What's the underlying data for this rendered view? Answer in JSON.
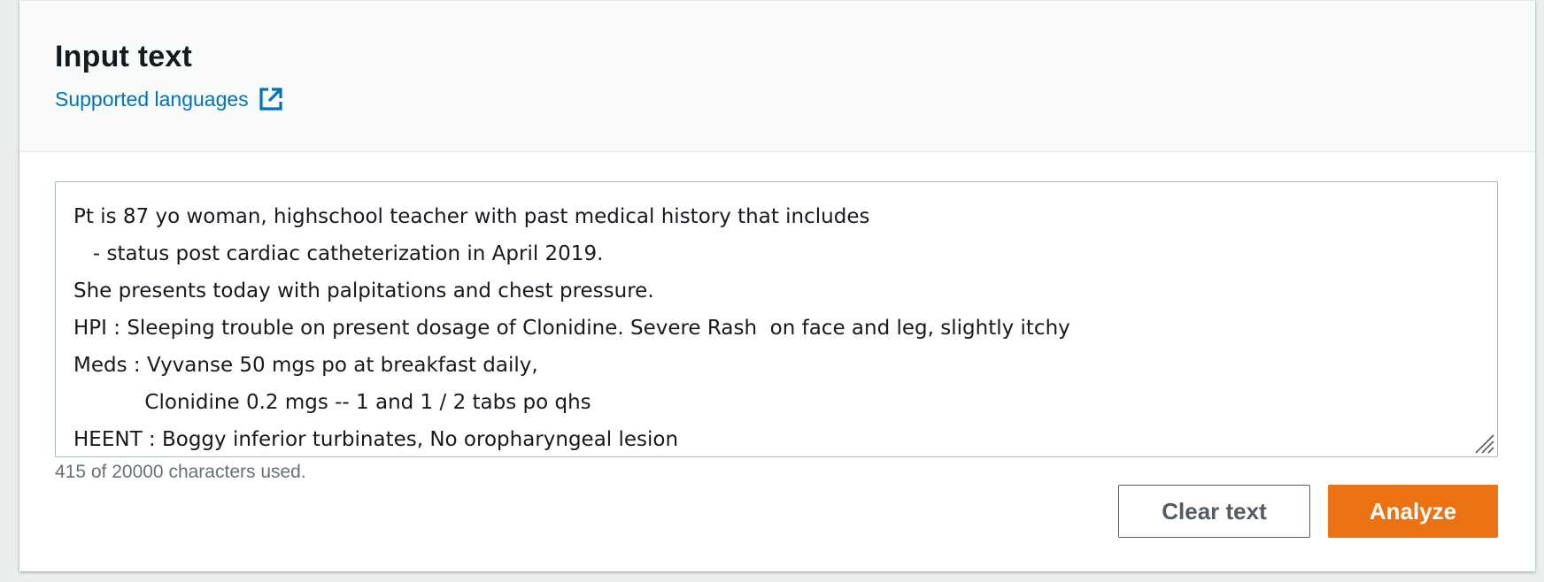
{
  "header": {
    "title": "Input text",
    "supported_languages_link": "Supported languages",
    "link_icon": "external-link-icon"
  },
  "input": {
    "value": "Pt is 87 yo woman, highschool teacher with past medical history that includes\n   - status post cardiac catheterization in April 2019.\nShe presents today with palpitations and chest pressure.\nHPI : Sleeping trouble on present dosage of Clonidine. Severe Rash  on face and leg, slightly itchy\nMeds : Vyvanse 50 mgs po at breakfast daily,\n           Clonidine 0.2 mgs -- 1 and 1 / 2 tabs po qhs\nHEENT : Boggy inferior turbinates, No oropharyngeal lesion",
    "char_count": "415 of 20000 characters used."
  },
  "buttons": {
    "clear_label": "Clear text",
    "analyze_label": "Analyze"
  },
  "colors": {
    "link": "#0073bb",
    "primary": "#ec7211",
    "secondary_border": "#545b64"
  }
}
